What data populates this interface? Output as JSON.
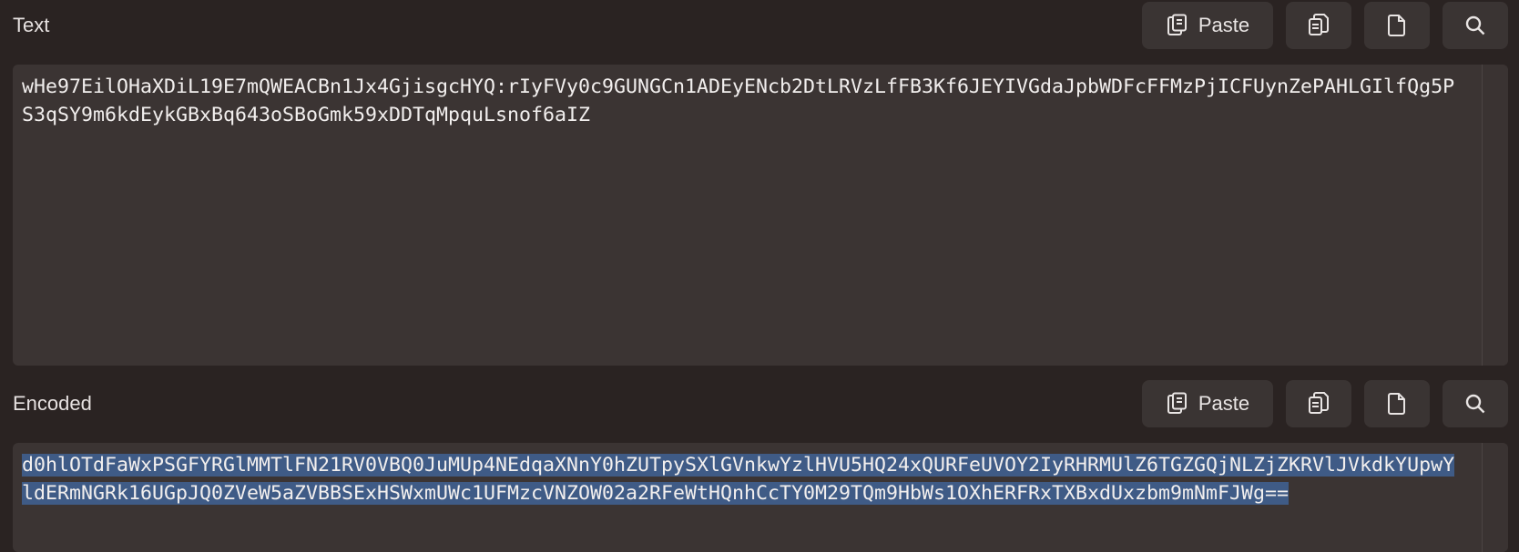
{
  "text_section": {
    "label": "Text",
    "paste_label": "Paste",
    "value": "wHe97EilOHaXDiL19E7mQWEACBn1Jx4GjisgcHYQ:rIyFVy0c9GUNGCn1ADEyENcb2DtLRVzLfFB3Kf6JEYIVGdaJpbWDFcFFMzPjICFUynZePAHLGIlfQg5PS3qSY9m6kdEykGBxBq643oSBoGmk59xDDTqMpquLsnof6aIZ"
  },
  "encoded_section": {
    "label": "Encoded",
    "paste_label": "Paste",
    "value": "d0hlOTdFaWxPSGFYRGlMMTlFN21RV0VBQ0JuMUp4NEdqaXNnY0hZUTpySXlGVnkwYzlHVU5HQ24xQURFeUVOY2IyRHRMUlZ6TGZGQjNLZjZKRVlJVkdkYUpwYldERmNGRk16UGpJQ0ZVeW5aZVBBSExHSWxmUWc1UFMzcVNZOW02a2RFeWtHQnhCcTY0M29TQm9HbWs1OXhERFRxTXBxdUxzbm9mNmFJWg=="
  },
  "icons": {
    "paste": "clipboard-paste-icon",
    "copy": "copy-icon",
    "file": "document-icon",
    "search": "search-icon"
  },
  "colors": {
    "background": "#2a2322",
    "field": "#3b3433",
    "button": "#3a3433",
    "selection": "#3f5b86"
  }
}
